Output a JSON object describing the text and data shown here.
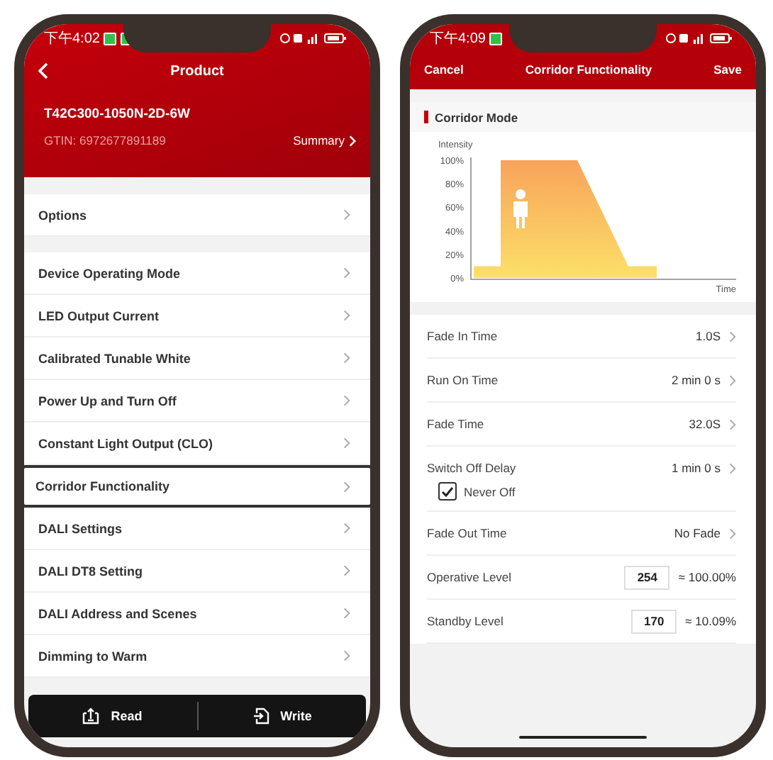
{
  "left_screen": {
    "status_bar": {
      "time": "下午4:02"
    },
    "header": {
      "title": "Product"
    },
    "product": {
      "name": "T42C300-1050N-2D-6W",
      "gtin": "GTIN: 6972677891189",
      "summary_link": "Summary"
    },
    "options_row": {
      "label": "Options"
    },
    "menu": [
      {
        "label": "Device Operating Mode",
        "selected": false
      },
      {
        "label": "LED Output Current",
        "selected": false
      },
      {
        "label": "Calibrated Tunable White",
        "selected": false
      },
      {
        "label": "Power Up and Turn Off",
        "selected": false
      },
      {
        "label": "Constant Light Output (CLO)",
        "selected": false
      },
      {
        "label": "Corridor Functionality",
        "selected": true
      },
      {
        "label": "DALI Settings",
        "selected": false
      },
      {
        "label": "DALI DT8 Setting",
        "selected": false
      },
      {
        "label": "DALI Address and Scenes",
        "selected": false
      },
      {
        "label": "Dimming to Warm",
        "selected": false
      }
    ],
    "action_bar": {
      "buttons": [
        {
          "kind": "read",
          "label": "Read"
        },
        {
          "kind": "write",
          "label": "Write"
        }
      ]
    }
  },
  "right_screen": {
    "status_bar": {
      "time": "下午4:09"
    },
    "header": {
      "cancel": "Cancel",
      "title": "Corridor Functionality",
      "save": "Save"
    },
    "section": {
      "title": "Corridor Mode"
    },
    "diagram": {
      "y_axis_title": "Intensity",
      "y_labels": [
        "100%",
        "80%",
        "60%",
        "40%",
        "20%",
        "0%"
      ],
      "x_axis_title": "Time"
    },
    "settings": [
      {
        "kind": "value",
        "label": "Fade In Time",
        "value": "1.0S"
      },
      {
        "kind": "value",
        "label": "Run On Time",
        "value": "2 min 0 s"
      },
      {
        "kind": "value",
        "label": "Fade Time",
        "value": "32.0S"
      },
      {
        "kind": "value",
        "label": "Switch Off Delay",
        "value": "1 min 0 s",
        "option": {
          "label": "Never Off",
          "checked": true
        }
      },
      {
        "kind": "value",
        "label": "Fade Out Time",
        "value": "No Fade"
      },
      {
        "kind": "input",
        "label": "Operative Level",
        "value": "254",
        "reading": "≈ 100.00%"
      },
      {
        "kind": "input",
        "label": "Standby Level",
        "value": "170",
        "reading": "≈ 10.09%"
      }
    ]
  }
}
